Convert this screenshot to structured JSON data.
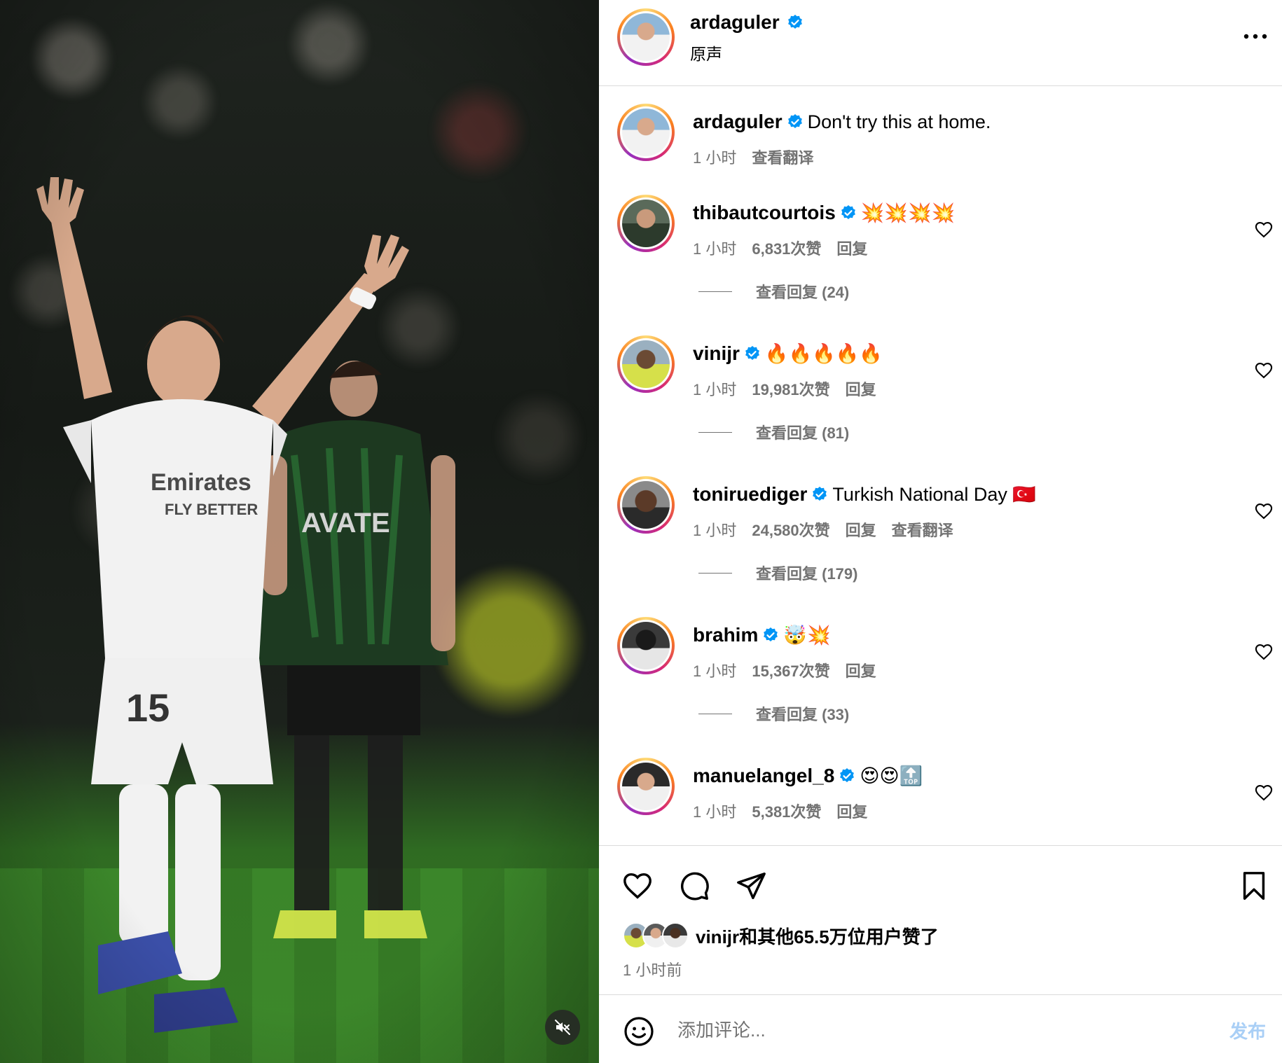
{
  "post": {
    "author": "ardaguler",
    "audio_label": "原声",
    "caption": "Don't try this at home.",
    "caption_time": "1 小时",
    "caption_translate": "查看翻译"
  },
  "comments": [
    {
      "username": "thibautcourtois",
      "text": "💥💥💥💥",
      "time": "1 小时",
      "likes": "6,831次赞",
      "reply": "回复",
      "view_replies": "查看回复 (24)"
    },
    {
      "username": "vinijr",
      "text": "🔥🔥🔥🔥🔥",
      "time": "1 小时",
      "likes": "19,981次赞",
      "reply": "回复",
      "view_replies": "查看回复 (81)"
    },
    {
      "username": "toniruediger",
      "text": "Turkish National Day 🇹🇷",
      "time": "1 小时",
      "likes": "24,580次赞",
      "reply": "回复",
      "translate": "查看翻译",
      "view_replies": "查看回复 (179)"
    },
    {
      "username": "brahim",
      "text": "🤯💥",
      "time": "1 小时",
      "likes": "15,367次赞",
      "reply": "回复",
      "view_replies": "查看回复 (33)"
    },
    {
      "username": "manuelangel_8",
      "text": "😍😍🔝",
      "time": "1 小时",
      "likes": "5,381次赞",
      "reply": "回复"
    }
  ],
  "actions": {
    "liked_by": "vinijr和其他65.5万位用户赞了",
    "post_time": "1 小时前"
  },
  "comment_box": {
    "placeholder": "添加评论...",
    "post_label": "发布"
  },
  "icons": {
    "verified": "verified-badge-icon",
    "more": "more-options-icon",
    "like": "heart-icon",
    "comment": "comment-bubble-icon",
    "share": "paper-plane-icon",
    "save": "bookmark-icon",
    "emoji": "smiley-icon",
    "mute": "speaker-muted-icon"
  },
  "colors": {
    "verified_blue": "#0095f6",
    "muted_text": "#737373",
    "post_button_disabled": "#a9cff6"
  }
}
